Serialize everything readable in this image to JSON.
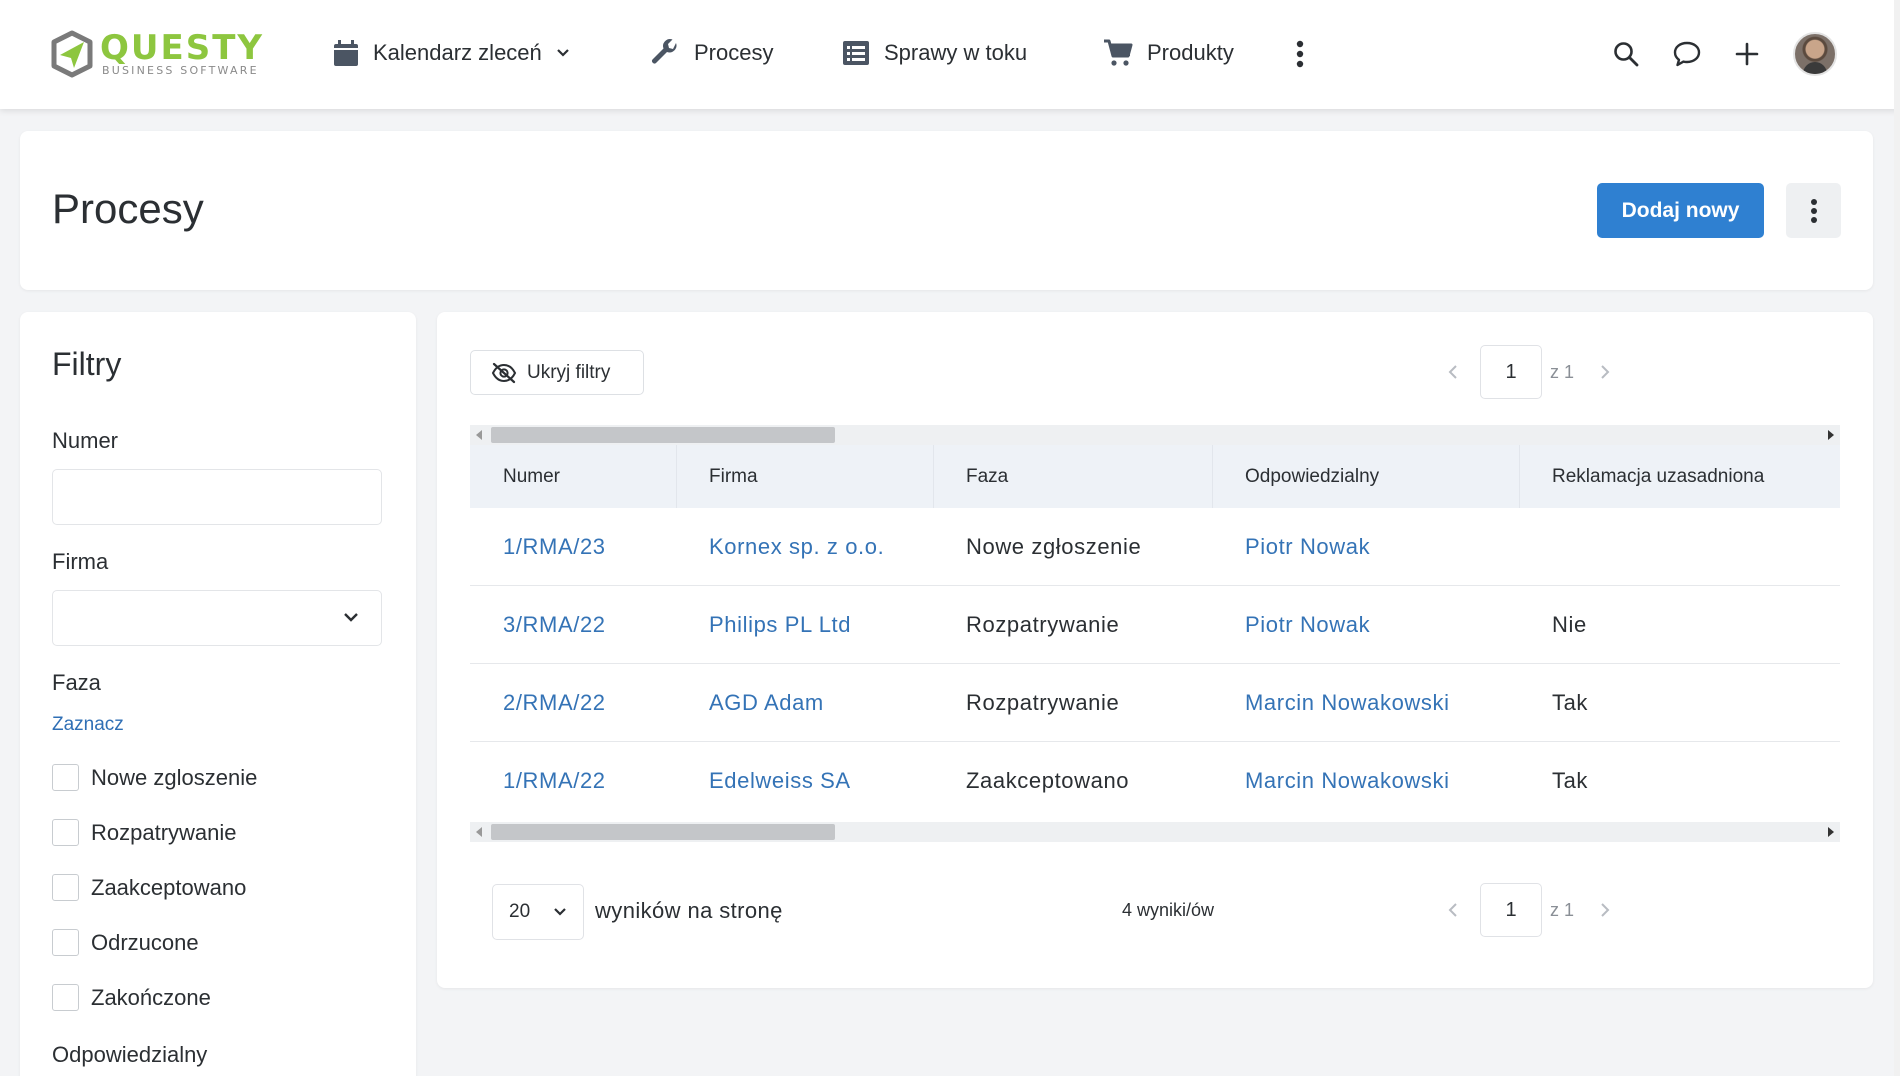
{
  "brand": {
    "name": "QUESTY",
    "tagline": "BUSINESS SOFTWARE",
    "green": "#8dc63f"
  },
  "nav": {
    "items": [
      {
        "label": "Kalendarz zleceń",
        "icon": "calendar-icon",
        "dropdown": true
      },
      {
        "label": "Procesy",
        "icon": "wrench-icon"
      },
      {
        "label": "Sprawy w toku",
        "icon": "list-icon"
      },
      {
        "label": "Produkty",
        "icon": "cart-icon"
      }
    ]
  },
  "header": {
    "title": "Procesy",
    "add_button": "Dodaj nowy"
  },
  "filters": {
    "title": "Filtry",
    "numer_label": "Numer",
    "numer_value": "",
    "firma_label": "Firma",
    "firma_value": "",
    "faza_label": "Faza",
    "select_link": "Zaznacz",
    "phases": [
      "Nowe zgloszenie",
      "Rozpatrywanie",
      "Zaakceptowano",
      "Odrzucone",
      "Zakończone"
    ],
    "odpowiedzialny_label": "Odpowiedzialny"
  },
  "results": {
    "hide_filters": "Ukryj filtry",
    "page": "1",
    "page_of": "z 1",
    "columns": [
      "Numer",
      "Firma",
      "Faza",
      "Odpowiedzialny",
      "Reklamacja uzasadniona"
    ],
    "rows": [
      {
        "numer": "1/RMA/23",
        "firma": "Kornex sp. z o.o.",
        "faza": "Nowe zgłoszenie",
        "odpowiedzialny": "Piotr Nowak",
        "reklamacja": ""
      },
      {
        "numer": "3/RMA/22",
        "firma": "Philips PL Ltd",
        "faza": "Rozpatrywanie",
        "odpowiedzialny": "Piotr Nowak",
        "reklamacja": "Nie"
      },
      {
        "numer": "2/RMA/22",
        "firma": "AGD Adam",
        "faza": "Rozpatrywanie",
        "odpowiedzialny": "Marcin Nowakowski",
        "reklamacja": "Tak"
      },
      {
        "numer": "1/RMA/22",
        "firma": "Edelweiss SA",
        "faza": "Zaakceptowano",
        "odpowiedzialny": "Marcin Nowakowski",
        "reklamacja": "Tak"
      }
    ],
    "per_page": "20",
    "per_page_label": "wyników na stronę",
    "count_label": "4 wyniki/ów"
  },
  "colors": {
    "primary": "#2f80d1",
    "link": "#3473b6"
  }
}
